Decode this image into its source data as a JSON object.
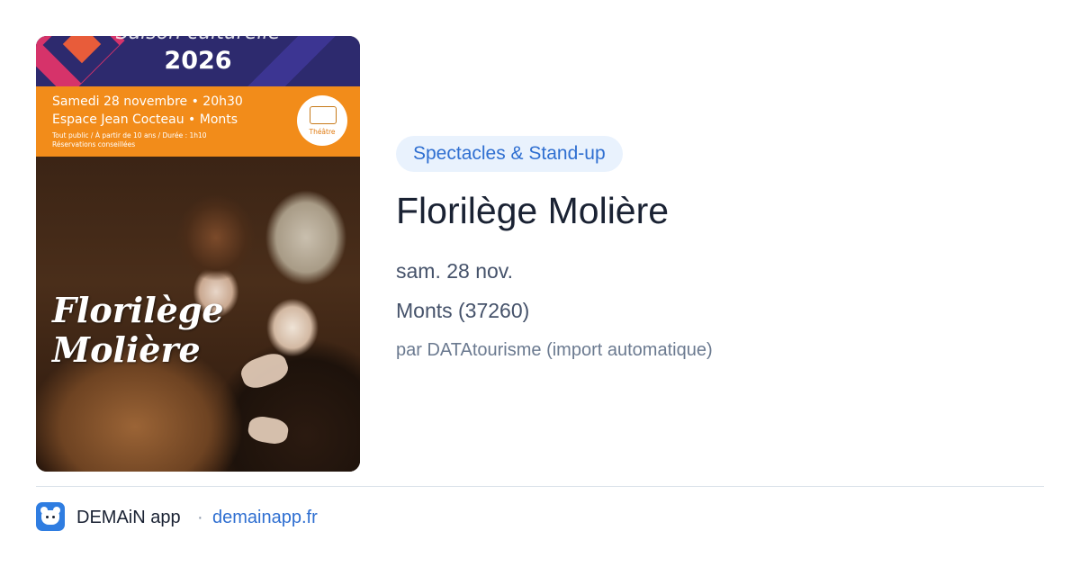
{
  "poster": {
    "season_text": "Saison culturelle",
    "year": "2026",
    "date_time": "Samedi 28 novembre • 20h30",
    "venue": "Espace Jean Cocteau • Monts",
    "audience_info": "Tout public / À partir de 10 ans / Durée : 1h10",
    "reservation_note": "Réservations conseillées",
    "logo_label": "Théâtre",
    "title_line1": "Florilège",
    "title_line2": "Molière",
    "colors": {
      "header_bg": "#2d2a6e",
      "band_bg": "#f28c1a"
    }
  },
  "event": {
    "category": "Spectacles & Stand-up",
    "title": "Florilège Molière",
    "date": "sam. 28 nov.",
    "location": "Monts (37260)",
    "source": "par DATAtourisme (import automatique)"
  },
  "footer": {
    "app_icon": "demain-app-icon",
    "app_name": "DEMAiN app",
    "separator": "·",
    "domain": "demainapp.fr"
  },
  "colors": {
    "accent": "#2f6fd1",
    "pill_bg": "#e9f2fd",
    "title": "#1a2233",
    "meta": "#45526a",
    "muted": "#6b7a90"
  }
}
